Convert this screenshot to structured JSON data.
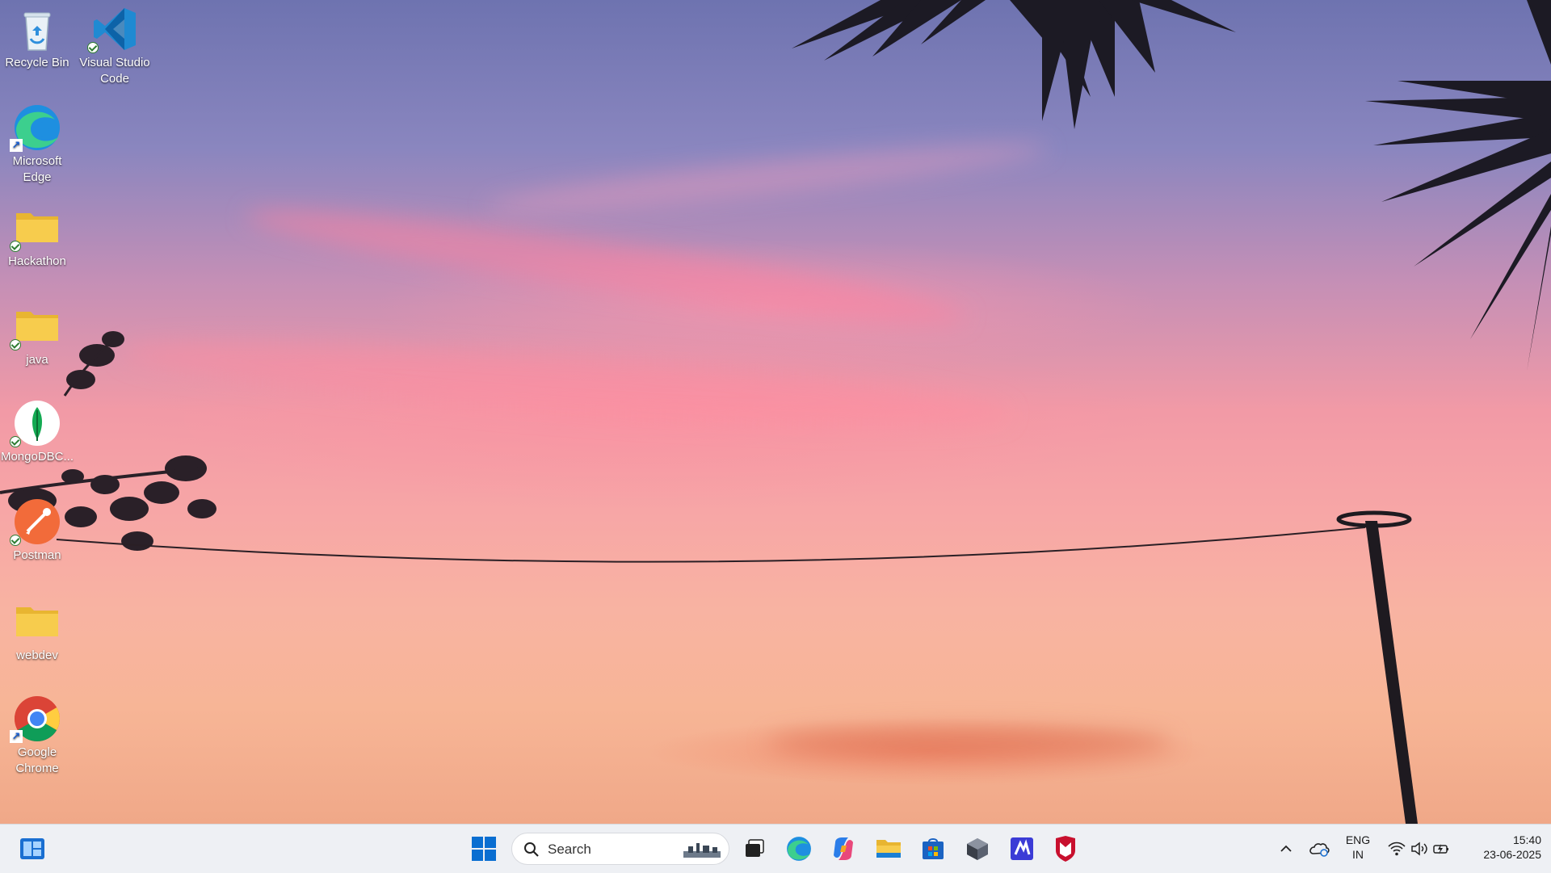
{
  "desktop": {
    "icons": [
      {
        "label": "Recycle Bin",
        "icon": "recycle-bin-icon"
      },
      {
        "label": "Visual Studio Code",
        "icon": "vscode-icon"
      },
      {
        "label": "Microsoft Edge",
        "icon": "edge-icon"
      },
      {
        "label": "Hackathon",
        "icon": "folder-icon"
      },
      {
        "label": "java",
        "icon": "folder-icon"
      },
      {
        "label": "MongoDBC...",
        "icon": "mongodb-compass-icon"
      },
      {
        "label": "Postman",
        "icon": "postman-icon"
      },
      {
        "label": "webdev",
        "icon": "folder-icon"
      },
      {
        "label": "Google Chrome",
        "icon": "chrome-icon"
      }
    ]
  },
  "taskbar": {
    "search_placeholder": "Search",
    "apps": [
      "widgets-icon",
      "start-icon",
      "task-view-icon",
      "edge-icon",
      "copilot-icon",
      "file-explorer-icon",
      "microsoft-store-icon",
      "app-icon",
      "app-icon",
      "mcafee-icon"
    ],
    "tray": {
      "language": "ENG",
      "region": "IN",
      "time": "15:40",
      "date": "23-06-2025"
    }
  },
  "colors": {
    "taskbar_bg": "#eef0f4",
    "windows_blue": "#0a6ed1",
    "folder_yellow": "#f5c542"
  }
}
